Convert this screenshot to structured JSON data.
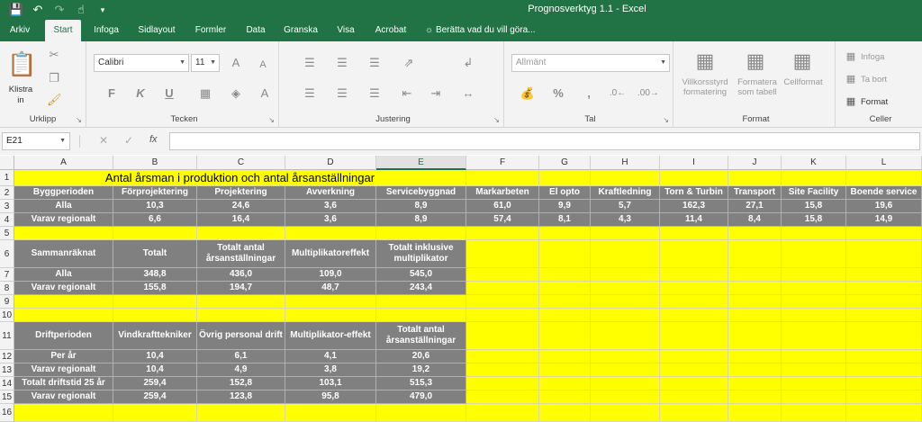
{
  "window": {
    "title": "Prognosverktyg 1.1  -  Excel"
  },
  "tabs": [
    "Arkiv",
    "Start",
    "Infoga",
    "Sidlayout",
    "Formler",
    "Data",
    "Granska",
    "Visa",
    "Acrobat"
  ],
  "tell_me": "Berätta vad du vill göra...",
  "ribbon": {
    "clipboard": {
      "paste_label": "Klistra",
      "paste_label2": "in",
      "group": "Urklipp"
    },
    "font": {
      "name": "Calibri",
      "size": "11",
      "group": "Tecken",
      "bold": "F",
      "italic": "K",
      "underline": "U"
    },
    "alignment": {
      "group": "Justering"
    },
    "number": {
      "format": "Allmänt",
      "group": "Tal",
      "percent": "%"
    },
    "styles": {
      "cond1": "Villkorsstyrd",
      "cond2": "formatering",
      "table1": "Formatera",
      "table2": "som tabell",
      "cellstyle": "Cellformat",
      "group": "Format"
    },
    "cells": {
      "insert": "Infoga",
      "delete": "Ta bort",
      "format": "Format",
      "group": "Celler"
    }
  },
  "formula_bar": {
    "name_box": "E21",
    "fx": "fx"
  },
  "sheet": {
    "columns": [
      "A",
      "B",
      "C",
      "D",
      "E",
      "F",
      "G",
      "H",
      "I",
      "J",
      "K",
      "L"
    ],
    "rows": [
      "1",
      "2",
      "3",
      "4",
      "5",
      "6",
      "7",
      "8",
      "9",
      "10",
      "11",
      "12",
      "13",
      "14",
      "15",
      "16"
    ],
    "title": "Antal årsman i produktion och antal årsanställningar",
    "r2": [
      "Byggperioden",
      "Förprojektering",
      "Projektering",
      "Avverkning",
      "Servicebyggnad",
      "Markarbeten",
      "El opto",
      "Kraftledning",
      "Torn & Turbin",
      "Transport",
      "Site Facility",
      "Boende service"
    ],
    "r3": [
      "Alla",
      "10,3",
      "24,6",
      "3,6",
      "8,9",
      "61,0",
      "9,9",
      "5,7",
      "162,3",
      "27,1",
      "15,8",
      "19,6"
    ],
    "r4": [
      "Varav regionalt",
      "6,6",
      "16,4",
      "3,6",
      "8,9",
      "57,4",
      "8,1",
      "4,3",
      "11,4",
      "8,4",
      "15,8",
      "14,9"
    ],
    "r6": [
      "Sammanräknat",
      "Totalt",
      "Totalt antal årsanställningar",
      "Multiplikatoreffekt",
      "Totalt inklusive multiplikator"
    ],
    "r7": [
      "Alla",
      "348,8",
      "436,0",
      "109,0",
      "545,0"
    ],
    "r8": [
      "Varav regionalt",
      "155,8",
      "194,7",
      "48,7",
      "243,4"
    ],
    "r11": [
      "Driftperioden",
      "Vindkrafttekniker",
      "Övrig personal drift",
      "Multiplikator-effekt",
      "Totalt antal årsanställningar"
    ],
    "r12": [
      "Per år",
      "10,4",
      "6,1",
      "4,1",
      "20,6"
    ],
    "r13": [
      "Varav regionalt",
      "10,4",
      "4,9",
      "3,8",
      "19,2"
    ],
    "r14": [
      "Totalt driftstid 25 år",
      "259,4",
      "152,8",
      "103,1",
      "515,3"
    ],
    "r15": [
      "Varav regionalt",
      "259,4",
      "123,8",
      "95,8",
      "479,0"
    ]
  },
  "colors": {
    "excel_green": "#217346",
    "highlight_yellow": "#ffff00",
    "header_gray": "#808080"
  }
}
